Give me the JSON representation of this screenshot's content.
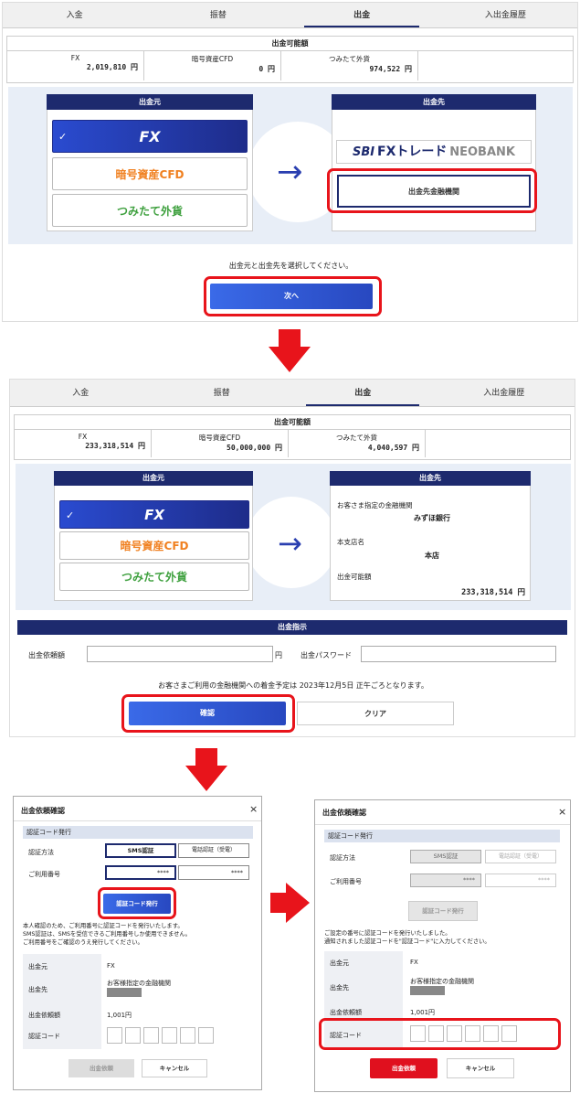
{
  "tabs": [
    "入金",
    "振替",
    "出金",
    "入出金履歴"
  ],
  "active_tab": "出金",
  "available": {
    "title": "出金可能額",
    "labels": [
      "FX",
      "暗号資産CFD",
      "つみたて外貨"
    ],
    "screen1_values": [
      "2,019,810 円",
      "0 円",
      "974,522 円"
    ],
    "screen2_values": [
      "233,318,514 円",
      "50,000,000 円",
      "4,040,597 円"
    ]
  },
  "source": {
    "header": "出金元",
    "options": [
      "FX",
      "暗号資産CFD",
      "つみたて外貨"
    ]
  },
  "destination": {
    "header": "出金先",
    "bank_logo_sbi": "SBI",
    "bank_logo_name": "FXトレード",
    "bank_logo_neo": "NEOBANK",
    "registered_button": "出金先金融機関",
    "info": [
      {
        "label": "お客さま指定の金融機関",
        "value": "みずほ銀行"
      },
      {
        "label": "本支店名",
        "value": "本店"
      },
      {
        "label": "出金可能額",
        "value": "233,318,514 円"
      }
    ]
  },
  "screen1": {
    "instruction": "出金元と出金先を選択してください。",
    "next_button": "次へ"
  },
  "screen2": {
    "section_title": "出金指示",
    "amount_label": "出金依頼額",
    "amount_unit": "円",
    "password_label": "出金パスワード",
    "notice": "お客さまご利用の金融機関への着金予定は 2023年12月5日 正午ごろとなります。",
    "confirm_button": "確認",
    "clear_button": "クリア"
  },
  "dialog": {
    "title": "出金依頼確認",
    "close": "×",
    "section": "認証コード発行",
    "method_label": "認証方法",
    "method_sms": "SMS認証",
    "method_phone": "電話認証（受電）",
    "number_label": "ご利用番号",
    "number1": "****",
    "number2": "****",
    "issue_button": "認証コード発行",
    "info1": "本人確認のため、ご利用番号に認証コードを発行いたします。\nSMS認証は、SMSを受信できるご利用番号しか使用できません。\nご利用番号をご確認のうえ発行してください。",
    "info2": "ご設定の番号に認証コードを発行いたしました。\n通知されました認証コードを\"認証コード\"に入力してください。",
    "rows": [
      {
        "label": "出金元",
        "value": "FX"
      },
      {
        "label": "出金先",
        "value": "お客様指定の金融機関"
      },
      {
        "label": "出金依頼額",
        "value": "1,001円"
      },
      {
        "label": "認証コード",
        "value": ""
      }
    ],
    "request_button": "出金依頼",
    "cancel_button": "キャンセル"
  },
  "colors": {
    "navy": "#1d2a6e",
    "red": "#e8141b",
    "blue": "#2f55d4"
  }
}
